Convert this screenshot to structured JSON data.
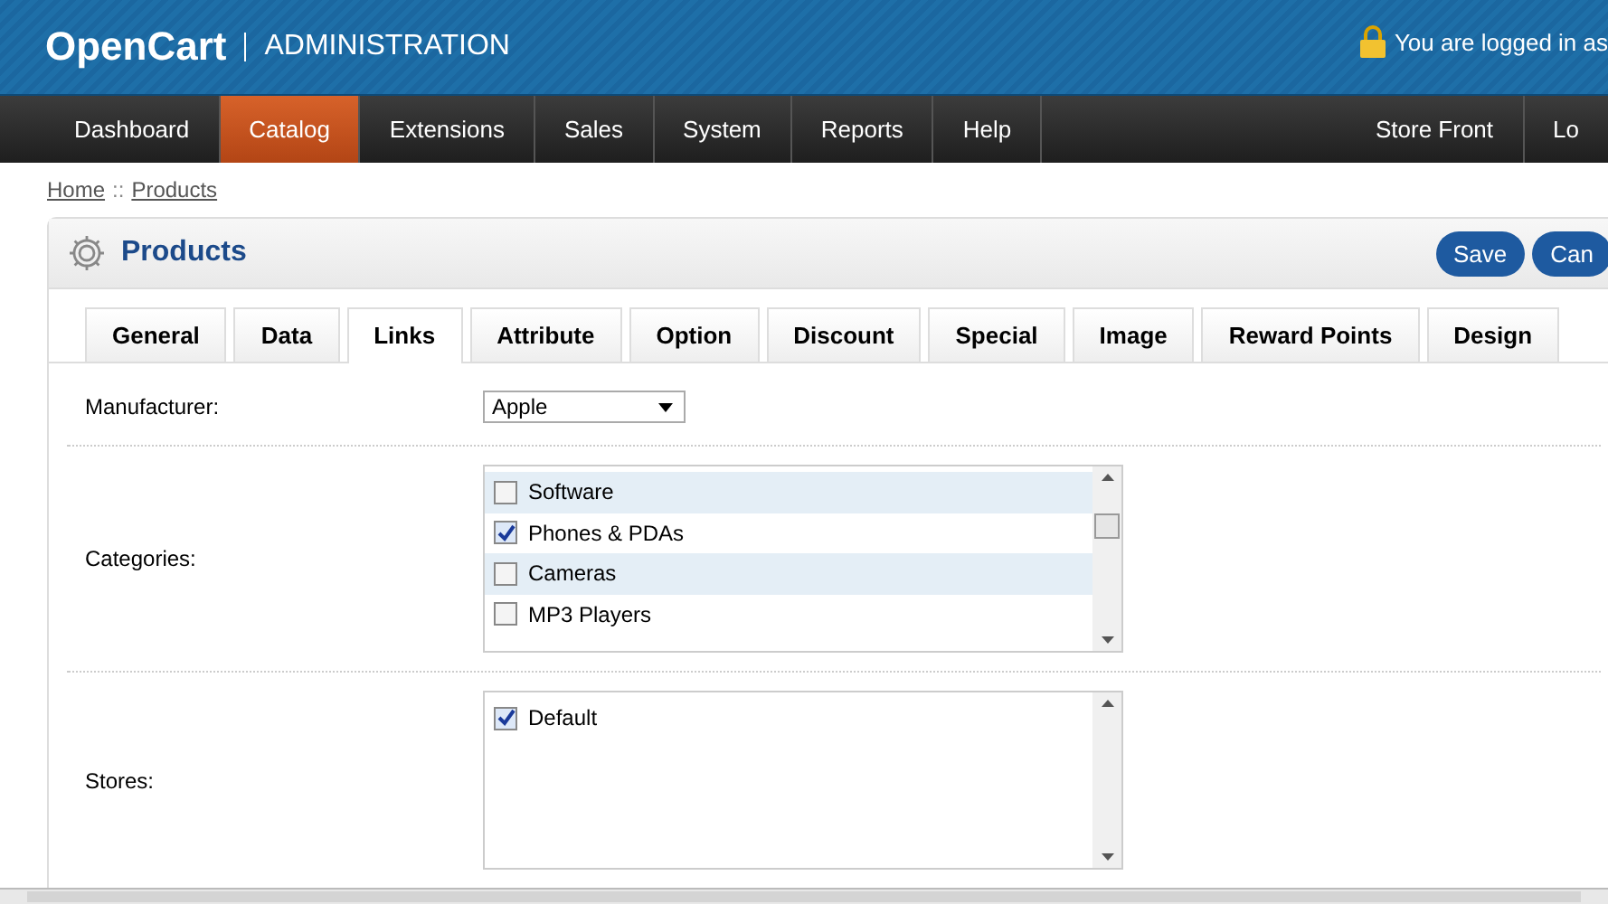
{
  "header": {
    "logo": "OpenCart",
    "subtitle": "ADMINISTRATION",
    "login_text": "You are logged in as"
  },
  "nav": {
    "items": [
      {
        "label": "Dashboard",
        "selected": false
      },
      {
        "label": "Catalog",
        "selected": true
      },
      {
        "label": "Extensions",
        "selected": false
      },
      {
        "label": "Sales",
        "selected": false
      },
      {
        "label": "System",
        "selected": false
      },
      {
        "label": "Reports",
        "selected": false
      },
      {
        "label": "Help",
        "selected": false
      }
    ],
    "right_items": [
      "Store Front",
      "Lo"
    ]
  },
  "breadcrumb": [
    "Home",
    "Products"
  ],
  "breadcrumb_separator": "::",
  "panel": {
    "title": "Products",
    "buttons": [
      "Save",
      "Can"
    ]
  },
  "tabs": [
    {
      "label": "General",
      "selected": false
    },
    {
      "label": "Data",
      "selected": false
    },
    {
      "label": "Links",
      "selected": true
    },
    {
      "label": "Attribute",
      "selected": false
    },
    {
      "label": "Option",
      "selected": false
    },
    {
      "label": "Discount",
      "selected": false
    },
    {
      "label": "Special",
      "selected": false
    },
    {
      "label": "Image",
      "selected": false
    },
    {
      "label": "Reward Points",
      "selected": false
    },
    {
      "label": "Design",
      "selected": false
    }
  ],
  "manufacturer": {
    "label": "Manufacturer:",
    "value": "Apple"
  },
  "categories": {
    "label": "Categories:",
    "items": [
      {
        "label": "Software",
        "checked": false
      },
      {
        "label": "Phones & PDAs",
        "checked": true
      },
      {
        "label": "Cameras",
        "checked": false
      },
      {
        "label": "MP3 Players",
        "checked": false
      }
    ]
  },
  "stores": {
    "label": "Stores:",
    "items": [
      {
        "label": "Default",
        "checked": true
      }
    ]
  }
}
